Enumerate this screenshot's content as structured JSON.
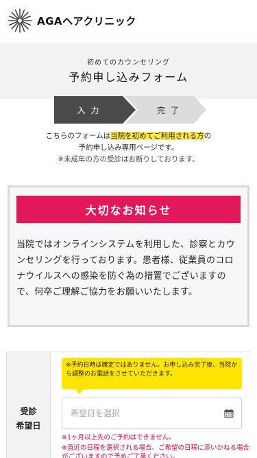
{
  "header": {
    "logo_text": "AGAヘアクリニック",
    "logo_icon": "starburst-logo"
  },
  "hero": {
    "subtitle": "初めてのカウンセリング",
    "title": "予約申し込みフォーム"
  },
  "steps": [
    {
      "label": "入力",
      "active": true
    },
    {
      "label": "完了",
      "active": false
    }
  ],
  "intro": {
    "line1_pre": "こちらのフォームは",
    "line1_highlight": "当院を初めてご利用される方",
    "line1_post": "の",
    "line2": "予約申し込み専用ページです。",
    "line3": "※未成年の方の受診はお断りしております。"
  },
  "notice": {
    "title": "大切なお知らせ",
    "body": "当院ではオンラインシステムを利用した、診察とカウンセリングを行っております。患者様、従業員のコロナウイルスへの感染を防ぐ為の措置でございますので、何卒ご理解ご協力をお願いいたします。",
    "title_color": "#e2185b"
  },
  "form": {
    "label_line1": "受診",
    "label_line2": "希望日",
    "tip": "※予約日時は確定ではありません。お申し込み完了後、当院から調整のお電話をさせていただきます。",
    "date_placeholder": "希望日を選択",
    "warning_1": "※1ヶ月以上先のご予約はできません。",
    "warning_2": "※直近の日程を選択される場合、ご希望の日程に添いかねる場合がございますので予めご了承ください。",
    "calendar_icon": "calendar-icon"
  }
}
